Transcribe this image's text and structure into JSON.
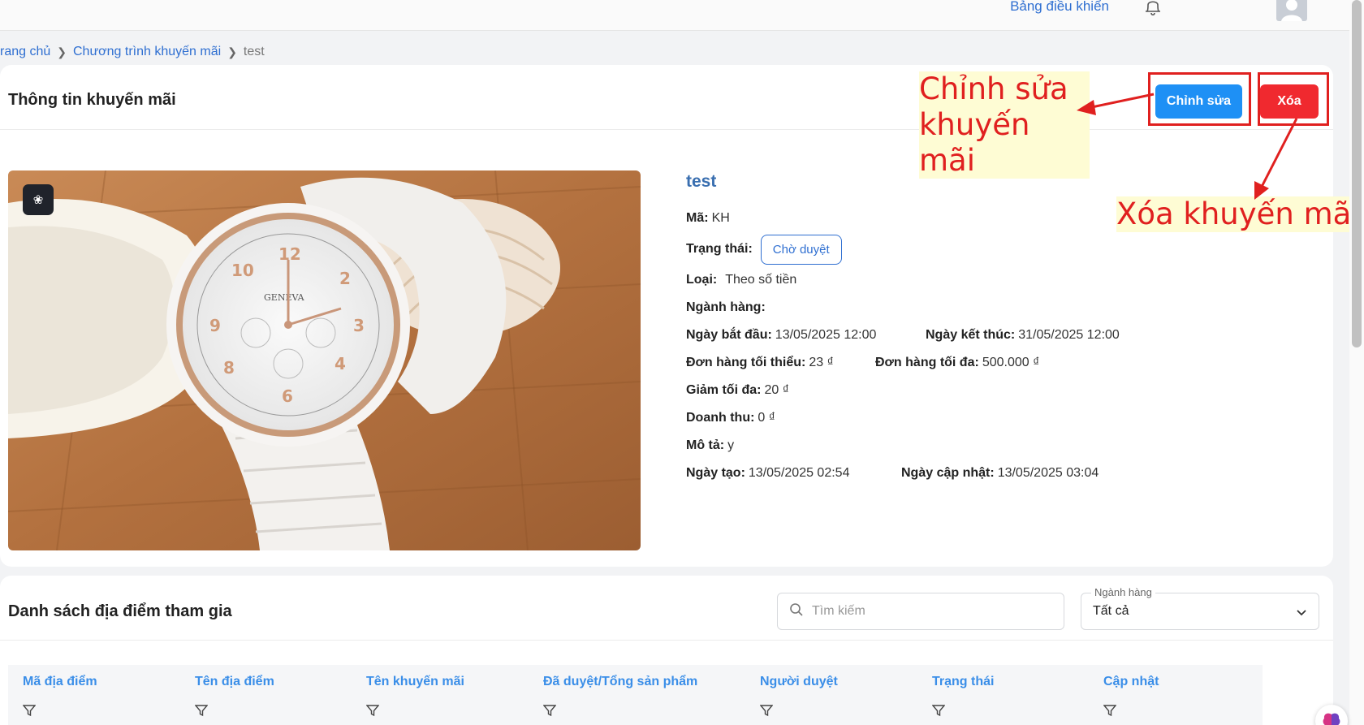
{
  "topbar": {
    "dashboard_label": "Bảng điều khiển"
  },
  "breadcrumb": {
    "home": "rang chủ",
    "section": "Chương trình khuyến mãi",
    "current": "test"
  },
  "promo_card": {
    "title": "Thông tin khuyến mãi",
    "edit_label": "Chỉnh sửa",
    "delete_label": "Xóa",
    "image_alt": "GENEVA",
    "name": "test",
    "code_label": "Mã:",
    "code": "KH",
    "status_label": "Trạng thái:",
    "status": "Chờ duyệt",
    "type_label": "Loại:",
    "type": "Theo số tiền",
    "industry_label": "Ngành hàng:",
    "industry": "",
    "start_label": "Ngày bắt đầu:",
    "start": "13/05/2025 12:00",
    "end_label": "Ngày kết thúc:",
    "end": "31/05/2025 12:00",
    "min_order_label": "Đơn hàng tối thiểu:",
    "min_order": "23 ₫",
    "max_order_label": "Đơn hàng tối đa:",
    "max_order": "500.000 ₫",
    "max_discount_label": "Giảm tối đa:",
    "max_discount": "20 ₫",
    "revenue_label": "Doanh thu:",
    "revenue": "0 ₫",
    "desc_label": "Mô tả:",
    "desc": "y",
    "created_label": "Ngày tạo:",
    "created": "13/05/2025 02:54",
    "updated_label": "Ngày cập nhật:",
    "updated": "13/05/2025 03:04"
  },
  "annotations": {
    "edit_line1": "Chỉnh sửa",
    "edit_line2": "khuyến mãi",
    "delete": "Xóa khuyến mãi",
    "color": "#e0201f"
  },
  "list_card": {
    "title": "Danh sách địa điểm tham gia",
    "search_placeholder": "Tìm kiếm",
    "industry_legend": "Ngành hàng",
    "industry_value": "Tất cả",
    "columns": [
      "Mã địa điểm",
      "Tên địa điểm",
      "Tên khuyến mãi",
      "Đã duyệt/Tổng sản phẩm",
      "Người duyệt",
      "Trạng thái",
      "Cập nhật"
    ]
  },
  "colors": {
    "primary": "#1e90f5",
    "danger": "#f0292f",
    "link": "#2f6fd1"
  }
}
